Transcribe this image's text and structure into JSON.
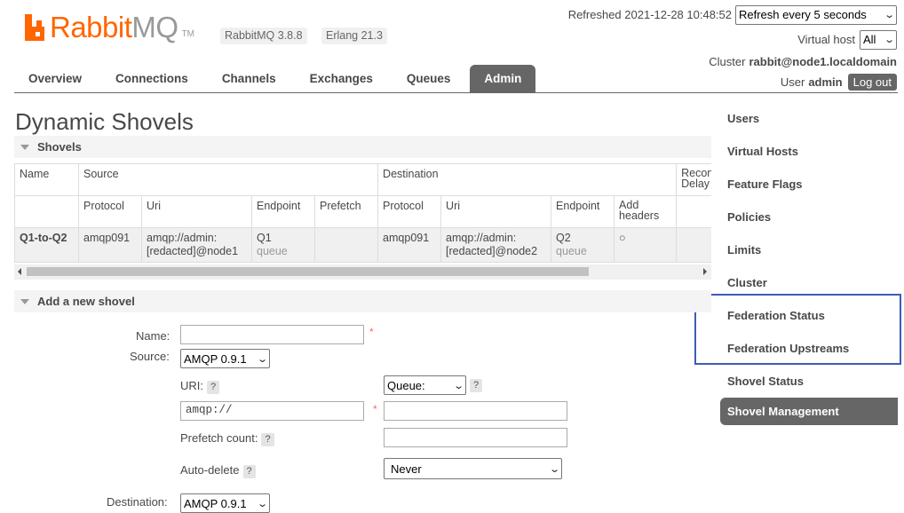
{
  "header": {
    "logo_rabbit": "Rabbit",
    "logo_mq": "MQ",
    "logo_tm": "TM",
    "version": "RabbitMQ 3.8.8",
    "erlang": "Erlang 21.3",
    "refreshed": "Refreshed 2021-12-28 10:48:52",
    "refresh_select": "Refresh every 5 seconds",
    "vhost_label": "Virtual host",
    "vhost_select": "All",
    "cluster_label": "Cluster",
    "cluster_name": "rabbit@node1.localdomain",
    "user_label": "User",
    "user_name": "admin",
    "logout": "Log out"
  },
  "tabs": [
    "Overview",
    "Connections",
    "Channels",
    "Exchanges",
    "Queues",
    "Admin"
  ],
  "active_tab": "Admin",
  "sidebar": [
    "Users",
    "Virtual Hosts",
    "Feature Flags",
    "Policies",
    "Limits",
    "Cluster",
    "Federation Status",
    "Federation Upstreams",
    "Shovel Status",
    "Shovel Management"
  ],
  "page_title": "Dynamic Shovels",
  "shovels_section": "Shovels",
  "table": {
    "group_name": "Name",
    "group_source": "Source",
    "group_destination": "Destination",
    "group_reconnect": "Reconnect Delay",
    "sub_protocol": "Protocol",
    "sub_uri": "Uri",
    "sub_endpoint": "Endpoint",
    "sub_prefetch": "Prefetch",
    "sub_add_headers": "Add headers",
    "row": {
      "name": "Q1-to-Q2",
      "src_protocol": "amqp091",
      "src_uri_1": "amqp://admin:",
      "src_uri_2": "[redacted]@node1",
      "src_endpoint": "Q1",
      "src_endpoint_type": "queue",
      "dst_protocol": "amqp091",
      "dst_uri_1": "amqp://admin:",
      "dst_uri_2": "[redacted]@node2",
      "dst_endpoint": "Q2",
      "dst_endpoint_type": "queue",
      "add_headers": "○"
    }
  },
  "add_section": "Add a new shovel",
  "form": {
    "name_label": "Name:",
    "name_value": "",
    "required": "*",
    "source_label": "Source:",
    "source_protocol": "AMQP 0.9.1",
    "uri_label": "URI:",
    "help": "?",
    "uri_value": "amqp://",
    "endpoint_type": "Queue:",
    "endpoint_value": "",
    "prefetch_label": "Prefetch count:",
    "prefetch_value": "",
    "autodelete_label": "Auto-delete",
    "autodelete_value": "Never",
    "destination_label": "Destination:",
    "destination_protocol": "AMQP 0.9.1"
  }
}
